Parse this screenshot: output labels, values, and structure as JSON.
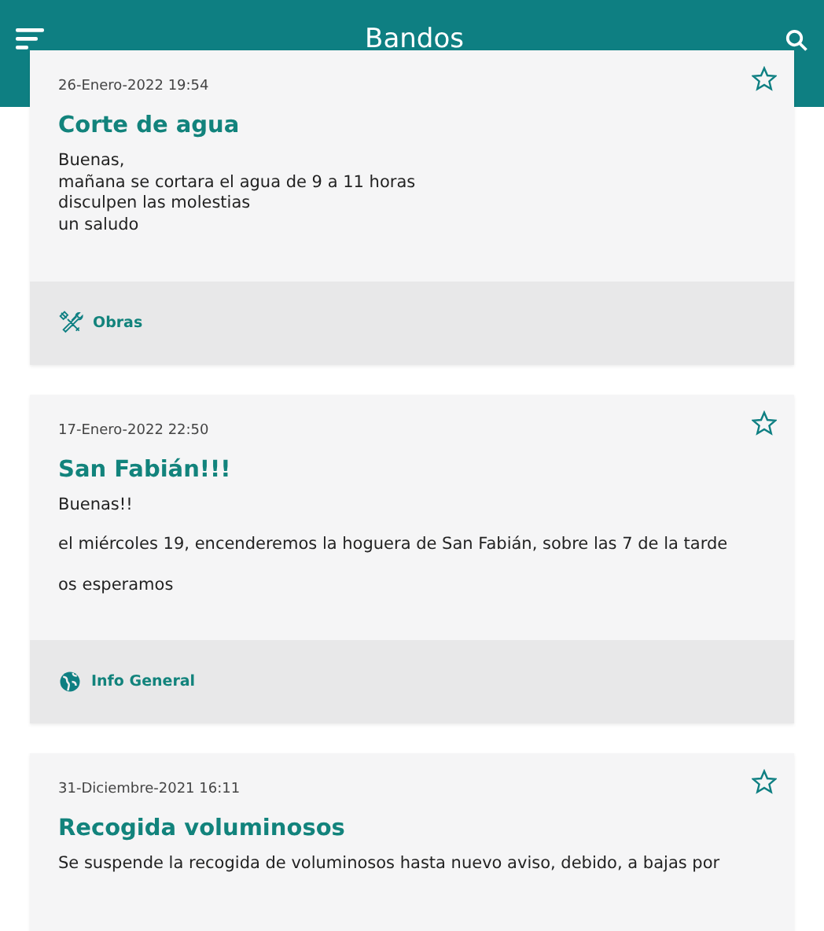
{
  "app_bar": {
    "title": "Bandos"
  },
  "posts": [
    {
      "date": "26-Enero-2022 19:54",
      "title": "Corte de agua",
      "starred": false,
      "paragraphs": [
        "Buenas,\nmañana se cortara el agua de 9 a 11 horas\ndisculpen las molestias\nun saludo"
      ],
      "category": {
        "kind": "tools",
        "label": "Obras"
      }
    },
    {
      "date": "17-Enero-2022 22:50",
      "title": "San Fabián!!!",
      "starred": false,
      "paragraphs": [
        "Buenas!!",
        "el miércoles 19, encenderemos la hoguera de San Fabián, sobre las 7 de la tarde",
        "os esperamos"
      ],
      "category": {
        "kind": "globe",
        "label": "Info General"
      }
    },
    {
      "date": "31-Diciembre-2021 16:11",
      "title": "Recogida voluminosos",
      "starred": false,
      "paragraphs": [
        "Se suspende la recogida de voluminosos hasta nuevo aviso, debido, a bajas por"
      ]
    }
  ]
}
